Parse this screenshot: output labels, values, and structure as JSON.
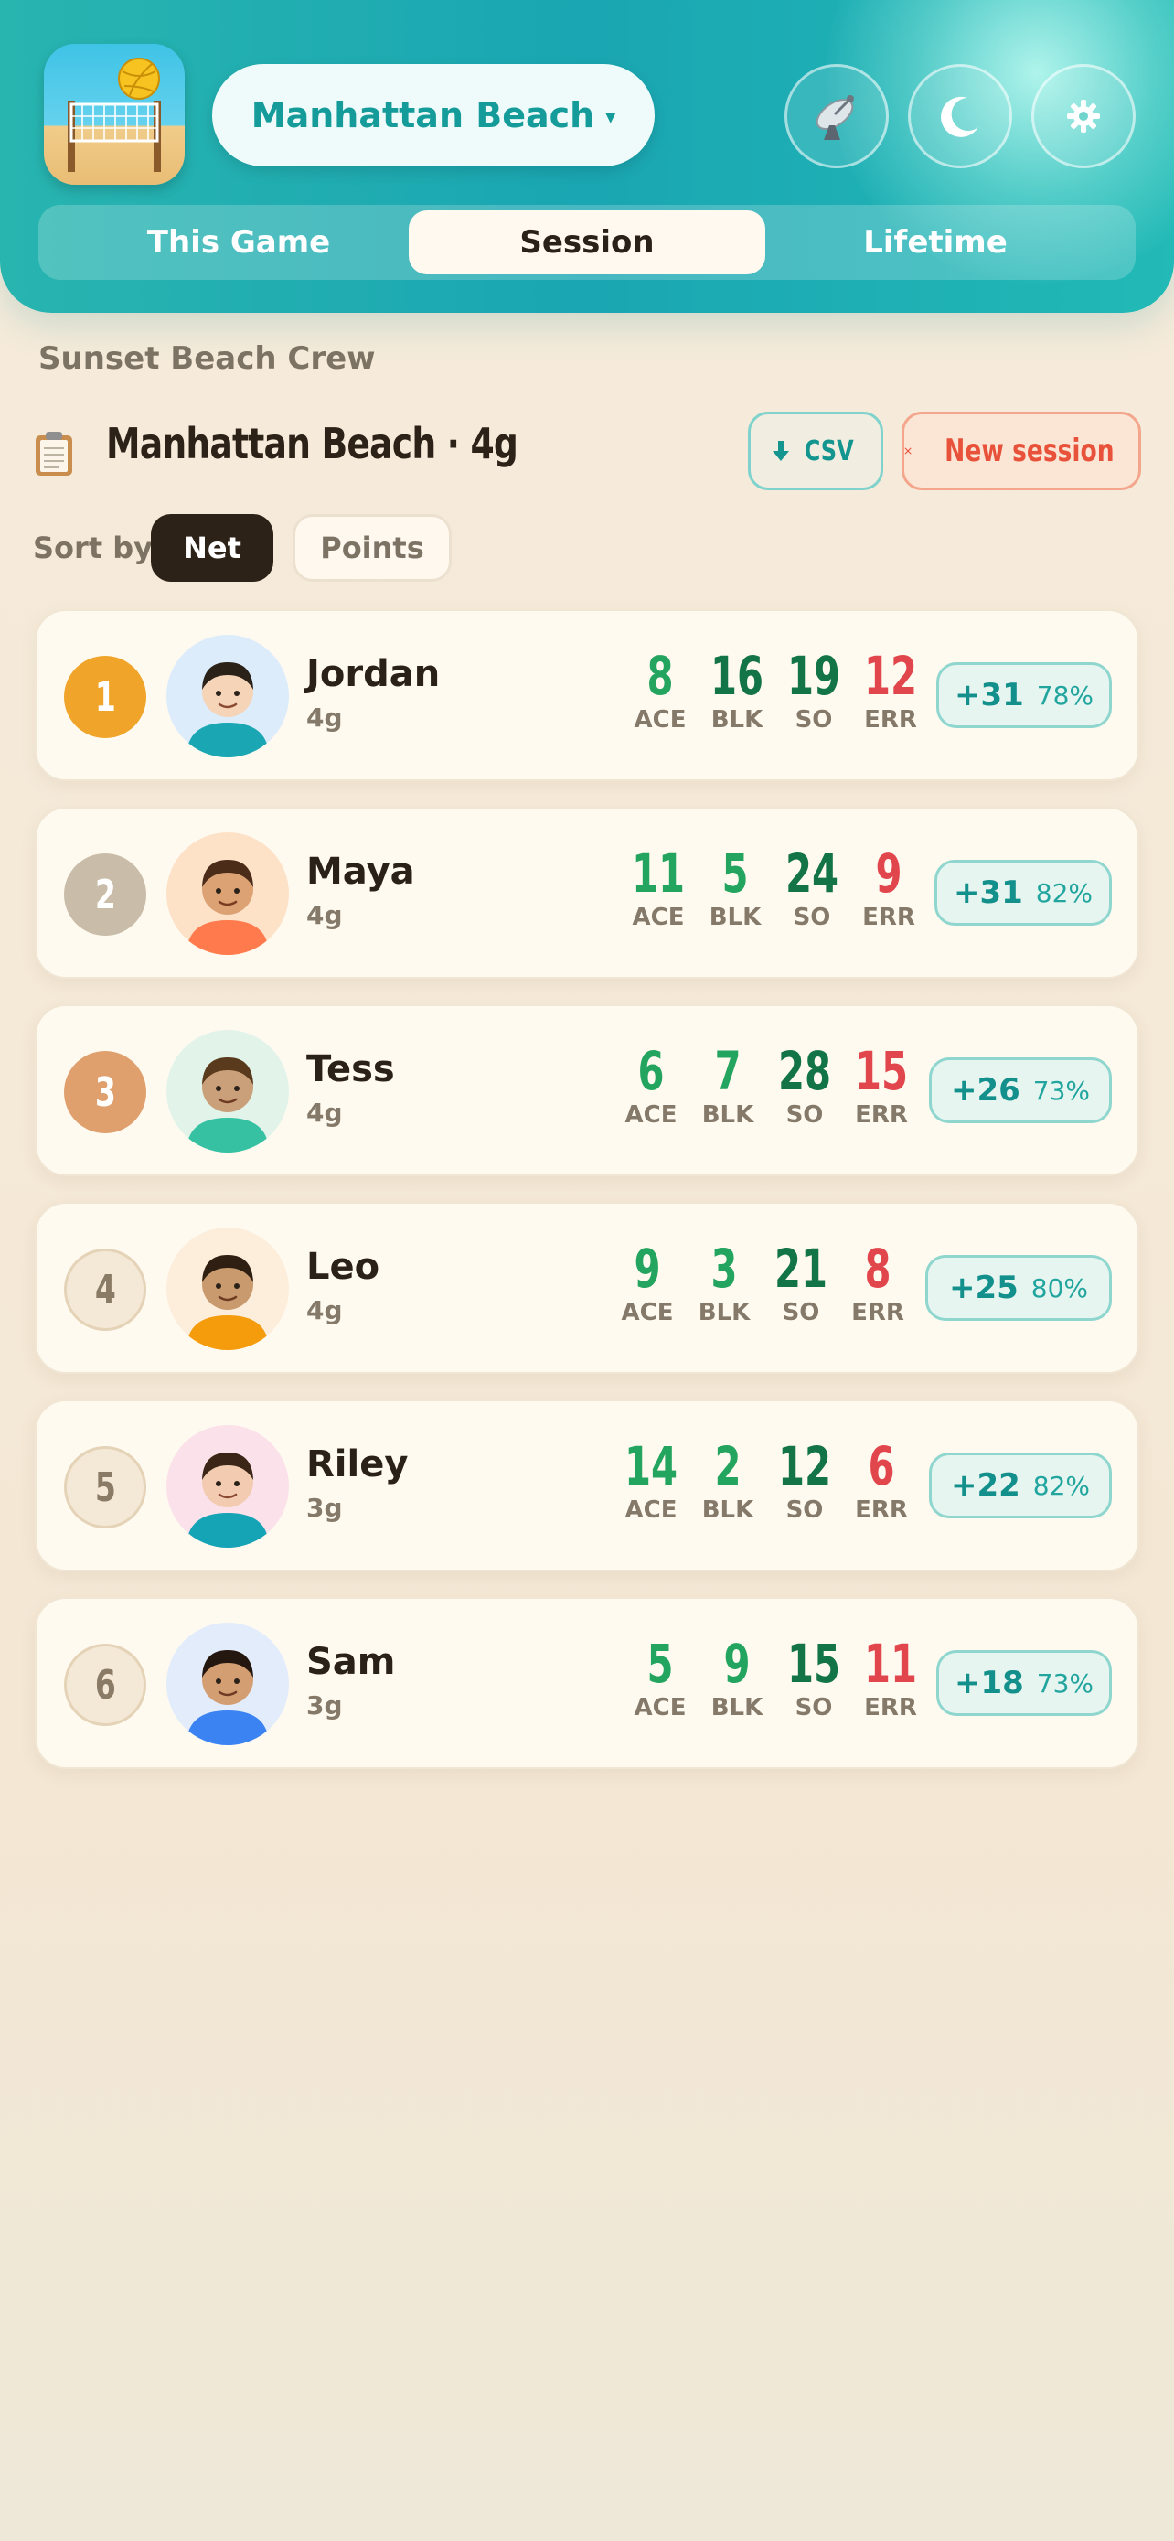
{
  "header": {
    "venue": "Manhattan Beach",
    "venue_chevron": "▾",
    "icons": [
      "volleyball-net-app-icon",
      "satellite-dish-icon",
      "moon-icon",
      "gear-icon"
    ],
    "tabs": [
      {
        "label": "This Game",
        "active": false
      },
      {
        "label": "Session",
        "active": true
      },
      {
        "label": "Lifetime",
        "active": false
      }
    ]
  },
  "group_name": "Sunset Beach Crew",
  "session": {
    "title": "Manhattan Beach · 4g",
    "csv_label": "CSV",
    "new_session_label": "New session"
  },
  "sort": {
    "label": "Sort by",
    "options": [
      {
        "label": "Net",
        "active": true
      },
      {
        "label": "Points",
        "active": false
      }
    ]
  },
  "stat_labels": {
    "ace": "ACE",
    "blk": "BLK",
    "so": "SO",
    "err": "ERR"
  },
  "players": [
    {
      "rank": "1",
      "name": "Jordan",
      "games": "4g",
      "ace": "8",
      "blk": "16",
      "so": "19",
      "err": "12",
      "net": "+31",
      "pct": "78%"
    },
    {
      "rank": "2",
      "name": "Maya",
      "games": "4g",
      "ace": "11",
      "blk": "5",
      "so": "24",
      "err": "9",
      "net": "+31",
      "pct": "82%"
    },
    {
      "rank": "3",
      "name": "Tess",
      "games": "4g",
      "ace": "6",
      "blk": "7",
      "so": "28",
      "err": "15",
      "net": "+26",
      "pct": "73%"
    },
    {
      "rank": "4",
      "name": "Leo",
      "games": "4g",
      "ace": "9",
      "blk": "3",
      "so": "21",
      "err": "8",
      "net": "+25",
      "pct": "80%"
    },
    {
      "rank": "5",
      "name": "Riley",
      "games": "3g",
      "ace": "14",
      "blk": "2",
      "so": "12",
      "err": "6",
      "net": "+22",
      "pct": "82%"
    },
    {
      "rank": "6",
      "name": "Sam",
      "games": "3g",
      "ace": "5",
      "blk": "9",
      "so": "15",
      "err": "11",
      "net": "+18",
      "pct": "73%"
    }
  ],
  "colors": {
    "header_teal": "#1aa6b2",
    "accent_teal": "#159c9a",
    "ace_green": "#23a45f",
    "dark_green": "#137447",
    "error_red": "#e2464d",
    "gold": "#f0a52a",
    "silver": "#c9bca8",
    "bronze": "#dfa06e"
  }
}
